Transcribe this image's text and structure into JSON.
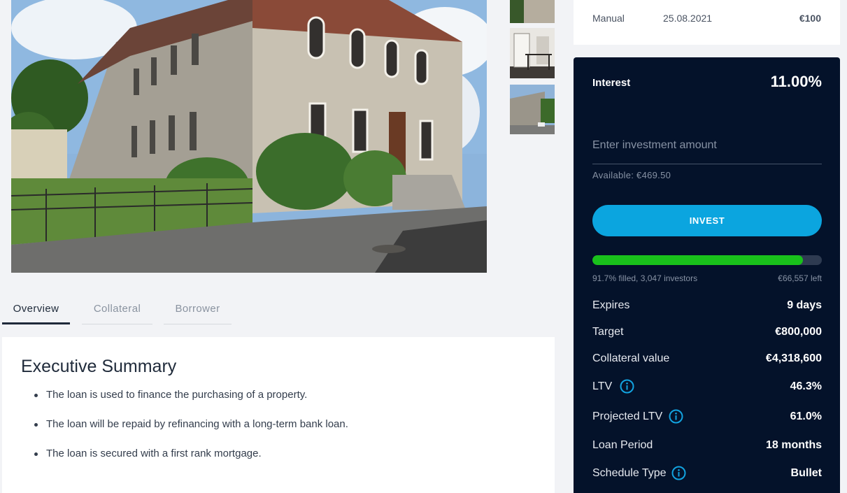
{
  "gallery": {
    "main_photo": "building-photo",
    "thumbnails": [
      "building-exterior",
      "hallway-interior",
      "building-side"
    ]
  },
  "tabs": [
    {
      "label": "Overview",
      "active": true
    },
    {
      "label": "Collateral",
      "active": false
    },
    {
      "label": "Borrower",
      "active": false
    }
  ],
  "summary": {
    "title": "Executive Summary",
    "items": [
      "The loan is used to finance the purchasing of a property.",
      "The loan will be repaid by refinancing with a long-term bank loan.",
      "The loan is secured with a first rank mortgage."
    ]
  },
  "investment_row": {
    "type": "Manual",
    "date": "25.08.2021",
    "amount": "€100"
  },
  "invest_panel": {
    "interest_label": "Interest",
    "interest_value": "11.00%",
    "amount_placeholder": "Enter investment amount",
    "available": "Available: €469.50",
    "invest_button": "INVEST",
    "progress_fraction": 0.917,
    "progress_text": "91.7% filled, 3,047 investors",
    "left_text": "€66,557 left",
    "stats": [
      {
        "label": "Expires",
        "value": "9 days",
        "info": false
      },
      {
        "label": "Target",
        "value": "€800,000",
        "info": false
      },
      {
        "label": "Collateral value",
        "value": "€4,318,600",
        "info": false
      },
      {
        "label": "LTV",
        "value": "46.3%",
        "info": true
      },
      {
        "label": "Projected LTV",
        "value": "61.0%",
        "info": true
      },
      {
        "label": "Loan Period",
        "value": "18 months",
        "info": false
      },
      {
        "label": "Schedule Type",
        "value": "Bullet",
        "info": true
      }
    ]
  },
  "colors": {
    "panel_bg": "#04122a",
    "invest_button": "#0ba5df",
    "progress_fill": "#19c11b",
    "info_icon": "#12a3e0"
  }
}
